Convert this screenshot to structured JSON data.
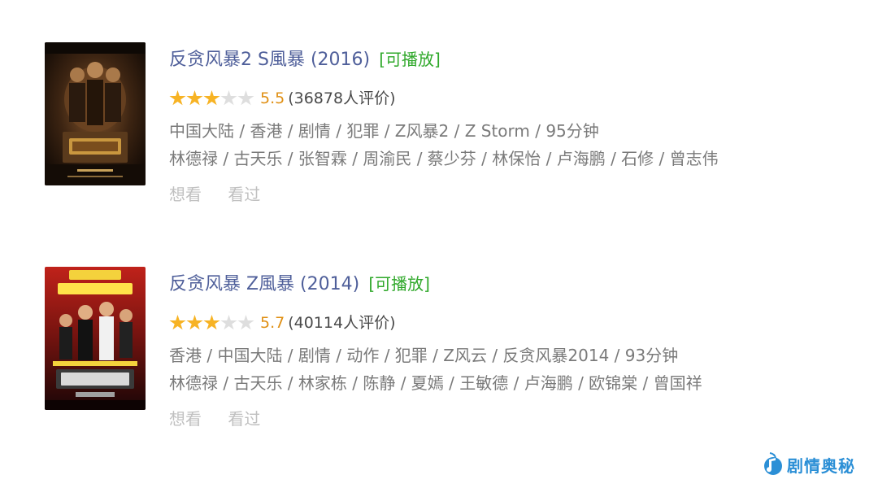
{
  "movies": [
    {
      "title": "反贪风暴2 S風暴 (2016)",
      "playable": "[可播放]",
      "stars": [
        "full",
        "full",
        "full",
        "empty",
        "empty"
      ],
      "score": "5.5",
      "votes": "(36878人评价)",
      "meta_line": "中国大陆 / 香港 / 剧情 / 犯罪 / Z风暴2 / Z Storm / 95分钟",
      "cast_line": "林德禄 / 古天乐 / 张智霖 / 周渝民 / 蔡少芬 / 林保怡 / 卢海鹏 / 石修 / 曾志伟",
      "want_label": "想看",
      "seen_label": "看过"
    },
    {
      "title": "反贪风暴 Z風暴 (2014)",
      "playable": "[可播放]",
      "stars": [
        "full",
        "full",
        "full",
        "empty",
        "empty"
      ],
      "score": "5.7",
      "votes": "(40114人评价)",
      "meta_line": "香港 / 中国大陆 / 剧情 / 动作 / 犯罪 / Z风云 / 反贪风暴2014 / 93分钟",
      "cast_line": "林德禄 / 古天乐 / 林家栋 / 陈静 / 夏嫣 / 王敏德 / 卢海鹏 / 欧锦棠 / 曾国祥",
      "want_label": "想看",
      "seen_label": "看过"
    }
  ],
  "watermark": {
    "text": "剧情奥秘",
    "icon": "music-note-logo-icon"
  },
  "colors": {
    "title": "#4f5f9a",
    "playable": "#2fa82a",
    "star": "#f7b324",
    "score": "#e09015",
    "meta": "#7a7a7a",
    "actions": "#c0c0c0",
    "watermark": "#2b8fd6"
  }
}
